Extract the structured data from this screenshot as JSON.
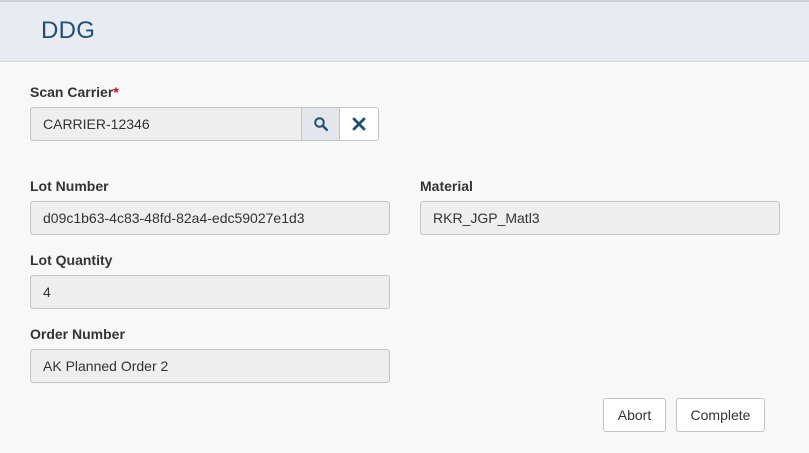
{
  "header": {
    "title": "DDG"
  },
  "scan_carrier": {
    "label": "Scan Carrier",
    "required_mark": "*",
    "value": "CARRIER-12346",
    "search_icon": "search-icon",
    "clear_icon": "close-icon"
  },
  "lot_number": {
    "label": "Lot Number",
    "value": "d09c1b63-4c83-48fd-82a4-edc59027e1d3"
  },
  "material": {
    "label": "Material",
    "value": "RKR_JGP_Matl3"
  },
  "lot_quantity": {
    "label": "Lot Quantity",
    "value": "4"
  },
  "order_number": {
    "label": "Order Number",
    "value": "AK Planned Order 2"
  },
  "actions": {
    "abort_label": "Abort",
    "complete_label": "Complete"
  },
  "colors": {
    "header_bg": "#e8ecf0",
    "title_color": "#1f4e79",
    "required_color": "#d0021b",
    "icon_color": "#1f4e79"
  }
}
